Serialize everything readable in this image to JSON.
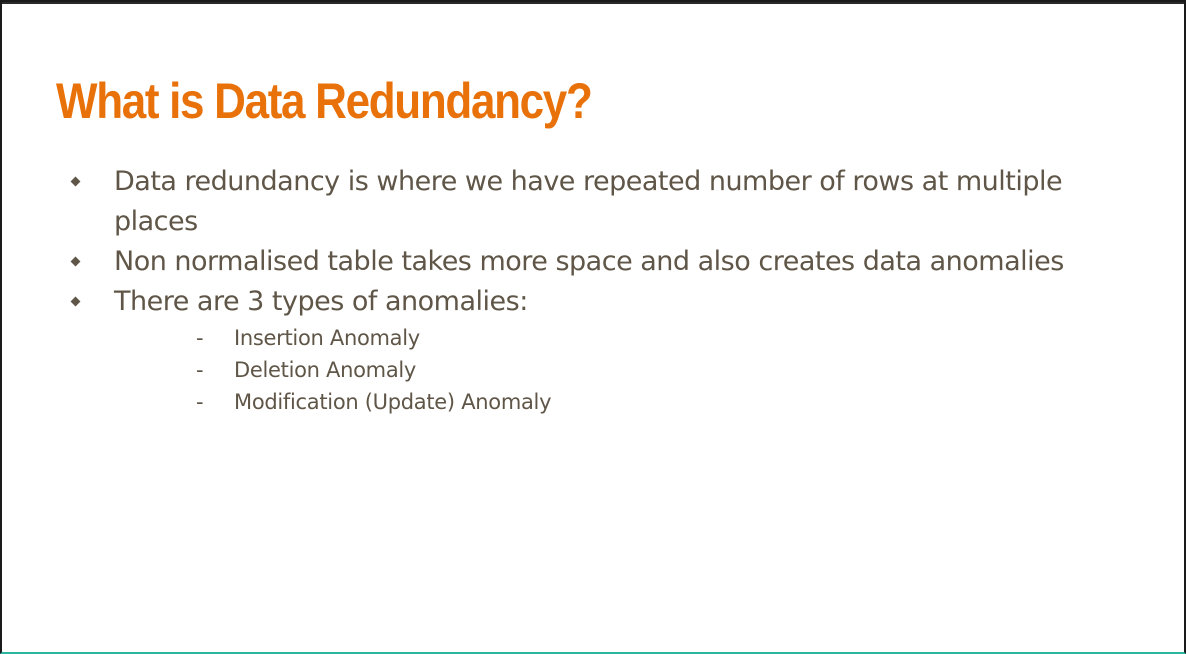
{
  "slide": {
    "title": "What is Data Redundancy?",
    "title_color": "#e8710a",
    "text_color": "#5f5648",
    "bullets": [
      {
        "text": "Data redundancy is where we have repeated number of rows at multiple places"
      },
      {
        "text": "Non normalised table takes more space and also creates data anomalies"
      },
      {
        "text": "There are 3 types of anomalies:"
      }
    ],
    "sub_items": [
      {
        "marker": "-",
        "text": "Insertion Anomaly"
      },
      {
        "marker": "-",
        "text": "Deletion Anomaly"
      },
      {
        "marker": "-",
        "text": "Modification (Update) Anomaly"
      }
    ]
  }
}
